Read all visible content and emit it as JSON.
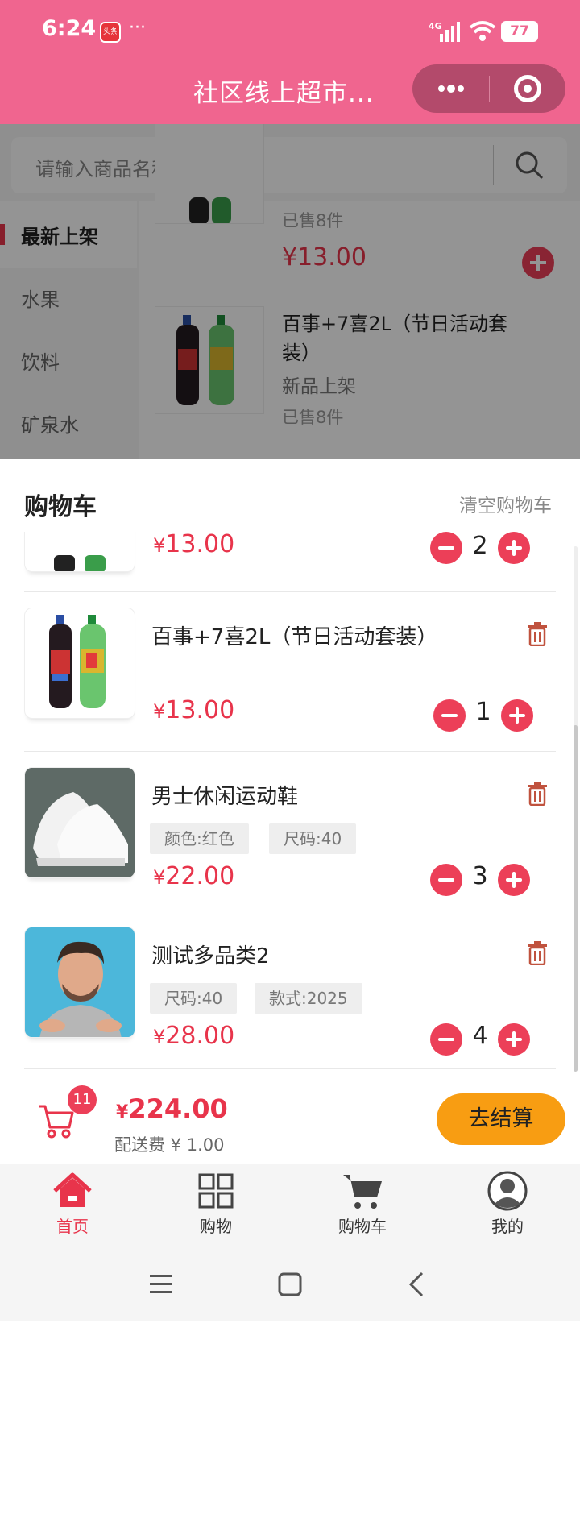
{
  "status_bar": {
    "time": "6:24",
    "app_badge": "头条",
    "more": "···",
    "network": "4G",
    "battery": "77"
  },
  "title_bar": {
    "title": "社区线上超市..."
  },
  "search": {
    "placeholder": "请输入商品名称"
  },
  "sidebar": {
    "items": [
      {
        "label": "最新上架",
        "active": true
      },
      {
        "label": "水果"
      },
      {
        "label": "饮料"
      },
      {
        "label": "矿泉水"
      }
    ]
  },
  "product_list": {
    "items": [
      {
        "sold": "已售8件",
        "price": "¥13.00"
      },
      {
        "name_line1": "百事+7喜2L（节日活动套",
        "name_line2": "装）",
        "tag": "新品上架",
        "sold": "已售8件"
      }
    ]
  },
  "cart": {
    "title": "购物车",
    "clear": "清空购物车",
    "items": [
      {
        "name": "",
        "price": "13.00",
        "qty": "2"
      },
      {
        "name": "百事+7喜2L（节日活动套装）",
        "price": "13.00",
        "qty": "1"
      },
      {
        "name": "男士休闲运动鞋",
        "specs": [
          "颜色:红色",
          "尺码:40"
        ],
        "price": "22.00",
        "qty": "3"
      },
      {
        "name": "测试多品类2",
        "specs": [
          "尺码:40",
          "款式:2025"
        ],
        "price": "28.00",
        "qty": "4"
      }
    ],
    "currency": "¥"
  },
  "checkout": {
    "count": "11",
    "currency": "¥",
    "total": "224.00",
    "delivery_fee": "配送费 ¥ 1.00",
    "button": "去结算"
  },
  "tabs": [
    {
      "label": "首页",
      "icon": "home-icon",
      "active": true
    },
    {
      "label": "购物",
      "icon": "grid-icon"
    },
    {
      "label": "购物车",
      "icon": "cart-icon"
    },
    {
      "label": "我的",
      "icon": "user-icon"
    }
  ],
  "colors": {
    "primary": "#f0658f",
    "price": "#e8344b",
    "button": "#f89d12"
  }
}
